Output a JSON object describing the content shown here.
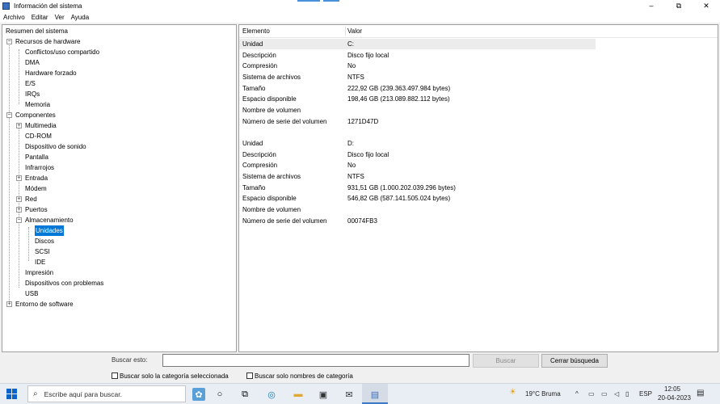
{
  "window": {
    "title": "Información del sistema",
    "controls": {
      "minimize": "–",
      "maximize": "⧉",
      "close": "✕"
    }
  },
  "menu": [
    "Archivo",
    "Editar",
    "Ver",
    "Ayuda"
  ],
  "tree": {
    "root": "Resumen del sistema",
    "hardware": {
      "label": "Recursos de hardware",
      "children": [
        "Conflictos/uso compartido",
        "DMA",
        "Hardware forzado",
        "E/S",
        "IRQs",
        "Memoria"
      ]
    },
    "components": {
      "label": "Componentes",
      "children": [
        "Multimedia",
        "CD-ROM",
        "Dispositivo de sonido",
        "Pantalla",
        "Infrarrojos",
        "Entrada",
        "Módem",
        "Red",
        "Puertos",
        "Almacenamiento"
      ],
      "storage_children": [
        "Unidades",
        "Discos",
        "SCSI",
        "IDE"
      ],
      "after_storage": [
        "Impresión",
        "Dispositivos con problemas",
        "USB"
      ]
    },
    "software": {
      "label": "Entorno de software"
    },
    "selected": "Unidades"
  },
  "grid": {
    "headers": [
      "Elemento",
      "Valor"
    ],
    "drive_c": [
      {
        "k": "Unidad",
        "v": "C:"
      },
      {
        "k": "Descripción",
        "v": "Disco fijo local"
      },
      {
        "k": "Compresión",
        "v": "No"
      },
      {
        "k": "Sistema de archivos",
        "v": "NTFS"
      },
      {
        "k": "Tamaño",
        "v": "222,92 GB (239.363.497.984 bytes)"
      },
      {
        "k": "Espacio disponible",
        "v": "198,46 GB (213.089.882.112 bytes)"
      },
      {
        "k": "Nombre de volumen",
        "v": ""
      },
      {
        "k": "Número de serie del volumen",
        "v": "1271D47D"
      }
    ],
    "drive_d": [
      {
        "k": "Unidad",
        "v": "D:"
      },
      {
        "k": "Descripción",
        "v": "Disco fijo local"
      },
      {
        "k": "Compresión",
        "v": "No"
      },
      {
        "k": "Sistema de archivos",
        "v": "NTFS"
      },
      {
        "k": "Tamaño",
        "v": "931,51 GB (1.000.202.039.296 bytes)"
      },
      {
        "k": "Espacio disponible",
        "v": "546,82 GB (587.141.505.024 bytes)"
      },
      {
        "k": "Nombre de volumen",
        "v": ""
      },
      {
        "k": "Número de serie del volumen",
        "v": "00074FB3"
      }
    ]
  },
  "search": {
    "label": "Buscar esto:",
    "value": "",
    "search_button": "Buscar",
    "close_button": "Cerrar búsqueda",
    "check_selected": "Buscar solo la categoría seleccionada",
    "check_names": "Buscar solo nombres de categoría"
  },
  "taskbar": {
    "search_placeholder": "Escribe aquí para buscar.",
    "weather": "19°C Bruma",
    "language": "ESP",
    "time": "12:05",
    "date": "20-04-2023"
  },
  "colors": {
    "selection": "#0078d7",
    "start": "#0a64c8"
  }
}
